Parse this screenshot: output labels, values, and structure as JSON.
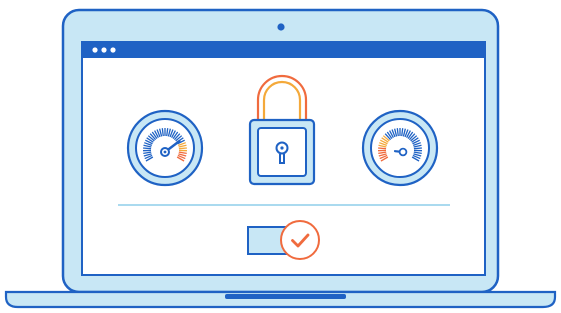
{
  "colors": {
    "outline": "#1f62c4",
    "laptop_shell": "#c8e7f5",
    "screen_bg": "#ffffff",
    "titlebar": "#1f62c4",
    "titlebar_dots": "#ffffff",
    "gauge_fill": "#c8e7f5",
    "accent_orange": "#f06b3e",
    "accent_yellow": "#f4a93a",
    "divider": "#8ecdea"
  },
  "icons": {
    "window_dots": "three-dots-icon",
    "left_gauge": "speedometer-icon",
    "center": "padlock-icon",
    "right_gauge": "speedometer-icon",
    "toggle": "toggle-switch-icon",
    "check": "checkmark-icon"
  },
  "state": {
    "left_gauge_fraction": 0.72,
    "right_gauge_fraction": 0.15,
    "padlock": "locked",
    "toggle": "on"
  }
}
